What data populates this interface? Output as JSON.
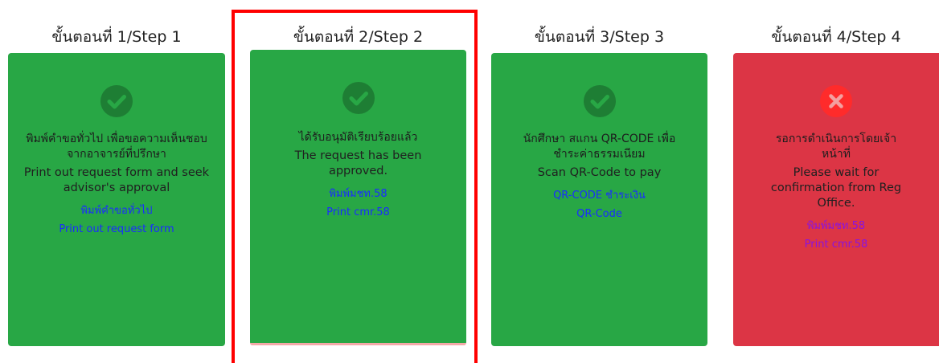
{
  "steps": [
    {
      "title": "ขั้นตอนที่ 1/Step 1",
      "status": "complete",
      "icon": "check-circle-icon",
      "thai_text": "พิมพ์คำขอทั่วไป เพื่อขอความเห็นชอบจากอาจารย์ที่ปรึกษา",
      "eng_text": "Print out request form and seek advisor's approval",
      "links": [
        "พิมพ์คำขอทั่วไป",
        "Print out request form"
      ]
    },
    {
      "title": "ขั้นตอนที่ 2/Step 2",
      "status": "complete",
      "icon": "check-circle-icon",
      "thai_text": "ได้รับอนุมัติเรียบร้อยแล้ว",
      "eng_text": "The request has been approved.",
      "links": [
        "พิมพ์มชท.58",
        "Print cmr.58"
      ]
    },
    {
      "title": "ขั้นตอนที่ 3/Step 3",
      "status": "complete",
      "icon": "check-circle-icon",
      "thai_text": "นักศึกษา สแกน QR-CODE เพื่อชำระค่าธรรมเนียม",
      "eng_text": "Scan QR-Code to pay",
      "links": [
        "QR-CODE ชำระเงิน",
        "QR-Code"
      ]
    },
    {
      "title": "ขั้นตอนที่ 4/Step 4",
      "status": "pending",
      "icon": "x-circle-icon",
      "thai_text": "รอการดำเนินการโดยเจ้าหน้าที่",
      "eng_text": "Please wait for confirmation from Reg Office.",
      "links": [
        "พิมพ์มชท.58",
        "Print cmr.58"
      ]
    }
  ],
  "colors": {
    "success": "#28a745",
    "danger": "#dc3545",
    "icon_dark": "#1e7e34",
    "icon_red": "#ff2b2b",
    "link_blue": "#1a2cff",
    "link_purple": "#8a13e0",
    "highlight": "#ff0000"
  }
}
